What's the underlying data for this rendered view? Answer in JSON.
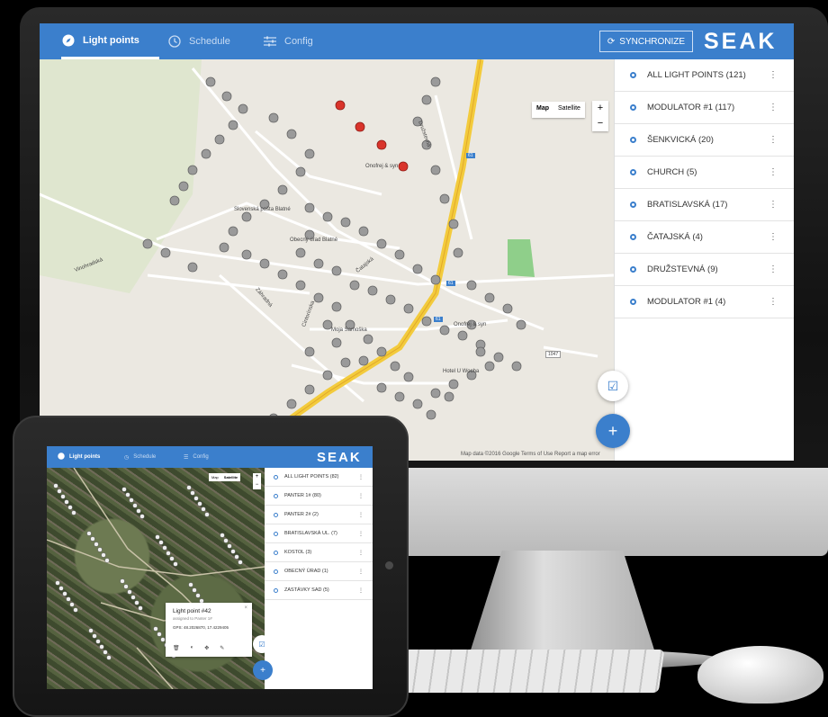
{
  "desktop": {
    "tabs": [
      {
        "label": "Light points",
        "icon": "compass-icon",
        "active": true
      },
      {
        "label": "Schedule",
        "icon": "clock-icon",
        "active": false
      },
      {
        "label": "Config",
        "icon": "sliders-icon",
        "active": false
      }
    ],
    "sync_label": "SYNCHRONIZE",
    "logo": "SEAK",
    "map": {
      "type_map": "Map",
      "type_satellite": "Satellite",
      "zoom_in": "+",
      "zoom_out": "−",
      "footer": "Map data ©2016 Google   Terms of Use   Report a map error",
      "labels": [
        "Onofrej & syn",
        "Slovenská pošta Blatné",
        "Obecný úrad Blatné",
        "Moja Samoška",
        "Onofrej & syn",
        "Hotel U Wocha",
        "Vinohradská",
        "Cintorínska",
        "Družstevná",
        "Záhradná",
        "Čatajská",
        "61",
        "61",
        "61",
        "1047"
      ]
    },
    "list": [
      {
        "label": "ALL LIGHT POINTS (121)"
      },
      {
        "label": "MODULATOR #1 (117)"
      },
      {
        "label": "ŠENKVICKÁ (20)"
      },
      {
        "label": "CHURCH (5)"
      },
      {
        "label": "BRATISLAVSKÁ (17)"
      },
      {
        "label": "ČATAJSKÁ (4)"
      },
      {
        "label": "DRUŽSTEVNÁ (9)"
      },
      {
        "label": "MODULATOR #1 (4)"
      }
    ],
    "more_icon": "⋮",
    "fab_small_icon": "☑",
    "fab_icon": "+"
  },
  "tablet": {
    "tabs": [
      {
        "label": "Light points"
      },
      {
        "label": "Schedule"
      },
      {
        "label": "Config"
      }
    ],
    "logo": "SEAK",
    "map_type_map": "Map",
    "map_type_satellite": "Satellite",
    "list": [
      {
        "label": "ALL LIGHT POINTS (82)"
      },
      {
        "label": "PANTER 1# (80)"
      },
      {
        "label": "PANTER 2# (2)"
      },
      {
        "label": "BRATISLAVSKÁ UL. (7)"
      },
      {
        "label": "KOSTOL (3)"
      },
      {
        "label": "OBECNÝ ÚRAD (1)"
      },
      {
        "label": "ZASTÁVKY SAD (5)"
      }
    ],
    "popup": {
      "title": "Light point #42",
      "subtitle": "assigned to Panter 1#",
      "gps": "GPS: 48.2026870, 17.4229405",
      "close": "×"
    }
  }
}
